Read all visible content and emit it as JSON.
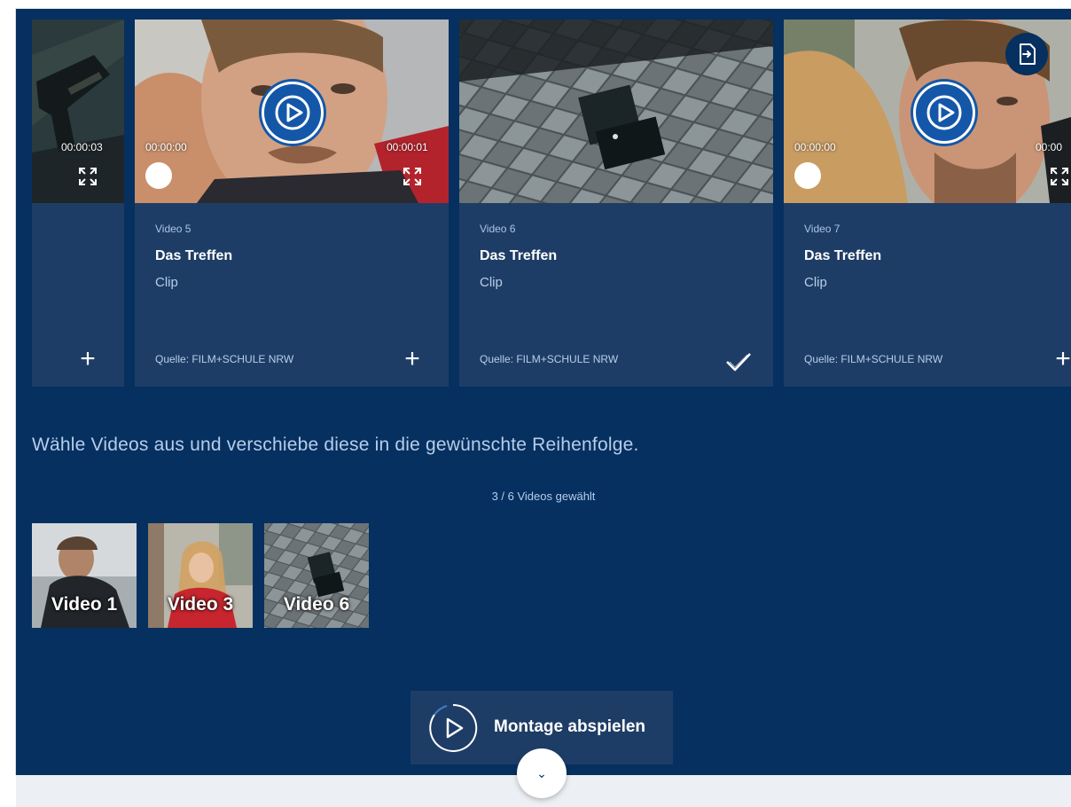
{
  "cards": [
    {
      "time_right": "00:00:03",
      "add_label": "+"
    },
    {
      "video_label": "Video 5",
      "title": "Das Treffen",
      "type": "Clip",
      "source": "Quelle: FILM+SCHULE NRW",
      "time_left": "00:00:00",
      "time_right": "00:00:01",
      "add_label": "+",
      "state": "not-selected"
    },
    {
      "video_label": "Video 6",
      "title": "Das Treffen",
      "type": "Clip",
      "source": "Quelle: FILM+SCHULE NRW",
      "state": "selected",
      "icon": "checkmark-icon"
    },
    {
      "video_label": "Video 7",
      "title": "Das Treffen",
      "type": "Clip",
      "source": "Quelle: FILM+SCHULE NRW",
      "time_left": "00:00:00",
      "time_right": "00:00",
      "add_label": "+",
      "state": "not-selected"
    }
  ],
  "instruction": "Wähle Videos aus und verschiebe diese in die gewünschte Reihenfolge.",
  "selection_count": "3 / 6 Videos gewählt",
  "selected_videos": [
    {
      "label": "Video 1"
    },
    {
      "label": "Video 3"
    },
    {
      "label": "Video 6"
    }
  ],
  "montage_button": {
    "label": "Montage abspielen",
    "icon": "play-circle-icon"
  },
  "scroll_down": {
    "icon": "chevron-down-icon",
    "glyph": "⌄"
  },
  "export_button": {
    "icon": "export-file-icon"
  },
  "colors": {
    "background": "#05305f",
    "card": "#1e3d66",
    "accent": "#1457a8",
    "muted_text": "#b7cdea"
  }
}
